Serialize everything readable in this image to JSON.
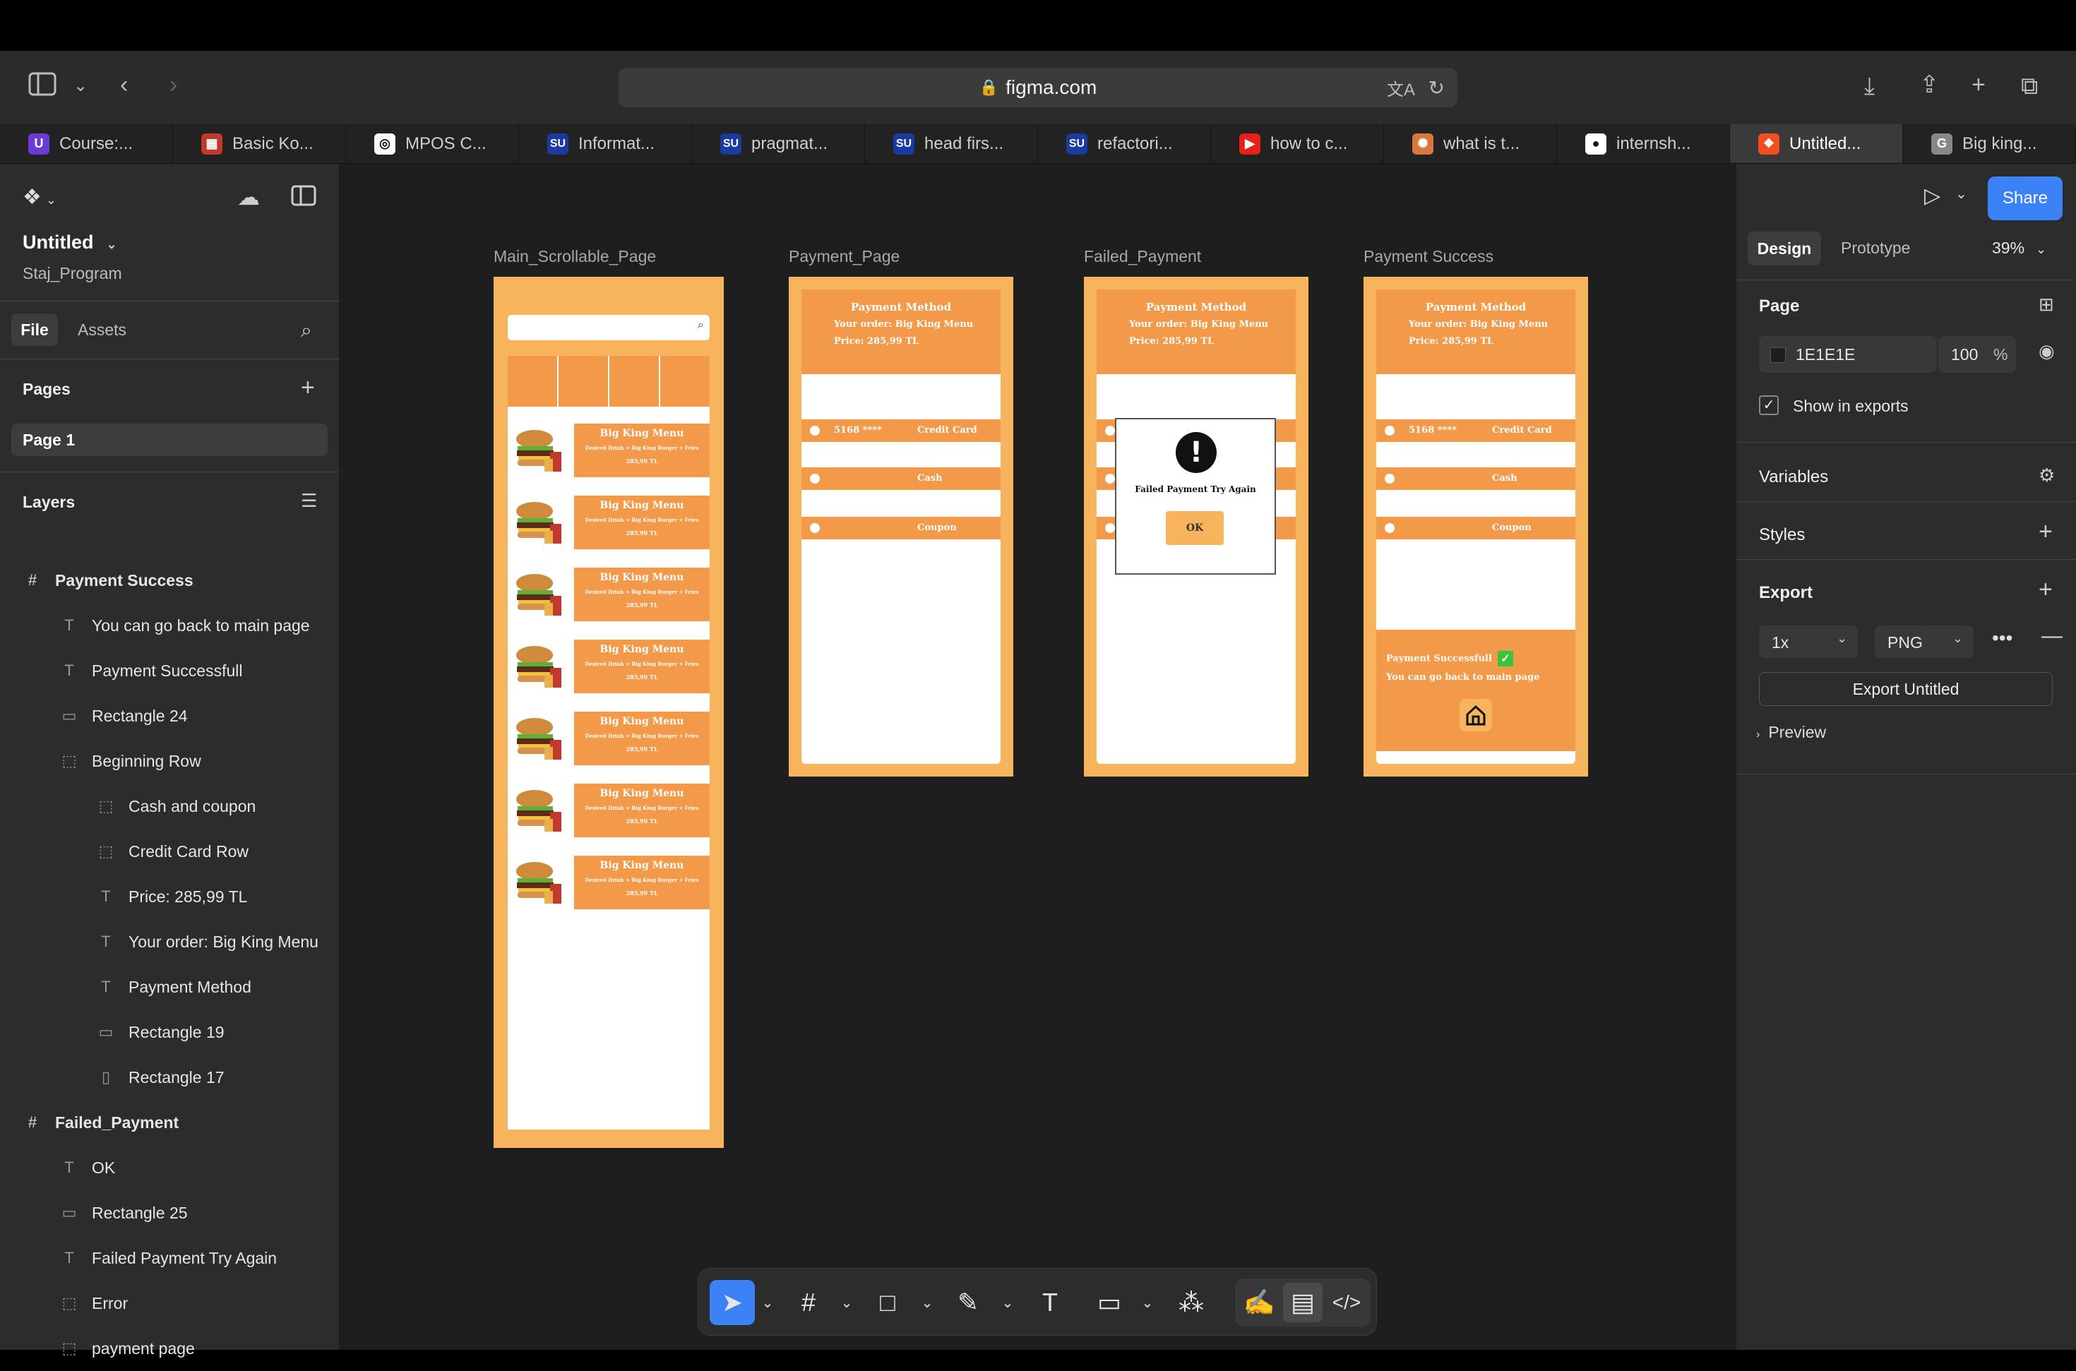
{
  "browser": {
    "url": "figma.com",
    "tabs": [
      {
        "label": "Course:...",
        "icon": "U",
        "color": "#6c3bd6"
      },
      {
        "label": "Basic Ko...",
        "icon": "calendar",
        "color": "#c0392b"
      },
      {
        "label": "MPOS C...",
        "icon": "openai",
        "color": "#ffffff"
      },
      {
        "label": "Informat...",
        "icon": "SU",
        "color": "#1a3aa0"
      },
      {
        "label": "pragmat...",
        "icon": "SU",
        "color": "#1a3aa0"
      },
      {
        "label": "head firs...",
        "icon": "SU",
        "color": "#1a3aa0"
      },
      {
        "label": "refactori...",
        "icon": "SU",
        "color": "#1a3aa0"
      },
      {
        "label": "how to c...",
        "icon": "youtube",
        "color": "#e62117"
      },
      {
        "label": "what is t...",
        "icon": "claude",
        "color": "#d9773f"
      },
      {
        "label": "internsh...",
        "icon": "github",
        "color": "#ffffff"
      },
      {
        "label": "Untitled...",
        "icon": "figma",
        "color": "#f24e1e",
        "active": true
      },
      {
        "label": "Big king...",
        "icon": "G",
        "color": "#888888"
      }
    ]
  },
  "file": {
    "name": "Untitled",
    "project": "Staj_Program"
  },
  "left_tabs": {
    "file": "File",
    "assets": "Assets"
  },
  "pages": {
    "title": "Pages",
    "items": [
      "Page 1"
    ]
  },
  "layers": {
    "title": "Layers",
    "items": [
      {
        "label": "Payment Success",
        "icon": "frame",
        "level": 0
      },
      {
        "label": "You can go back to main page",
        "icon": "text",
        "level": 1
      },
      {
        "label": "Payment Successfull",
        "icon": "text",
        "level": 1
      },
      {
        "label": "Rectangle 24",
        "icon": "rect",
        "level": 1
      },
      {
        "label": "Beginning Row",
        "icon": "group",
        "level": 1
      },
      {
        "label": "Cash and coupon",
        "icon": "group",
        "level": 2
      },
      {
        "label": "Credit Card Row",
        "icon": "group",
        "level": 2
      },
      {
        "label": "Price: 285,99 TL",
        "icon": "text",
        "level": 2
      },
      {
        "label": "Your order: Big King Menu",
        "icon": "text",
        "level": 2
      },
      {
        "label": "Payment Method",
        "icon": "text",
        "level": 2
      },
      {
        "label": "Rectangle 19",
        "icon": "rect",
        "level": 2
      },
      {
        "label": "Rectangle 17",
        "icon": "vrect",
        "level": 2
      },
      {
        "label": "Failed_Payment",
        "icon": "frame",
        "level": 0
      },
      {
        "label": "OK",
        "icon": "text",
        "level": 1
      },
      {
        "label": "Rectangle 25",
        "icon": "rect",
        "level": 1
      },
      {
        "label": "Failed Payment Try Again",
        "icon": "text",
        "level": 1
      },
      {
        "label": "Error",
        "icon": "group",
        "level": 1
      },
      {
        "label": "payment page",
        "icon": "group",
        "level": 1
      }
    ]
  },
  "frames": {
    "main": {
      "label": "Main_Scrollable_Page",
      "item_title": "Big King Menu",
      "item_sub": "Desired Drink + Big King Burger + Fries",
      "item_price": "285,99 TL",
      "item_count": 7
    },
    "payment": {
      "label": "Payment_Page"
    },
    "failed": {
      "label": "Failed_Payment",
      "error_text": "Failed Payment Try Again",
      "ok": "OK"
    },
    "success": {
      "label": "Payment Success",
      "msg1": "Payment Successfull",
      "msg2": "You can go back to main page"
    },
    "header": {
      "title": "Payment Method",
      "order": "Your order: Big King Menu",
      "price": "Price: 285,99 TL"
    },
    "rows": {
      "card_number": "5168 ****",
      "credit": "Credit Card",
      "cash": "Cash",
      "coupon": "Coupon"
    }
  },
  "right": {
    "share": "Share",
    "tabs": {
      "design": "Design",
      "prototype": "Prototype"
    },
    "zoom": "39%",
    "page": {
      "title": "Page",
      "color": "1E1E1E",
      "opacity": "100",
      "unit": "%",
      "show_in_exports": "Show in exports"
    },
    "variables": "Variables",
    "styles": "Styles",
    "export": {
      "title": "Export",
      "scale": "1x",
      "format": "PNG",
      "button": "Export Untitled",
      "preview": "Preview"
    }
  },
  "colors": {
    "accent": "#3b82f6",
    "frame_bg": "#f7b45d",
    "block": "#f29a4a",
    "canvas": "#1e1e1e"
  }
}
